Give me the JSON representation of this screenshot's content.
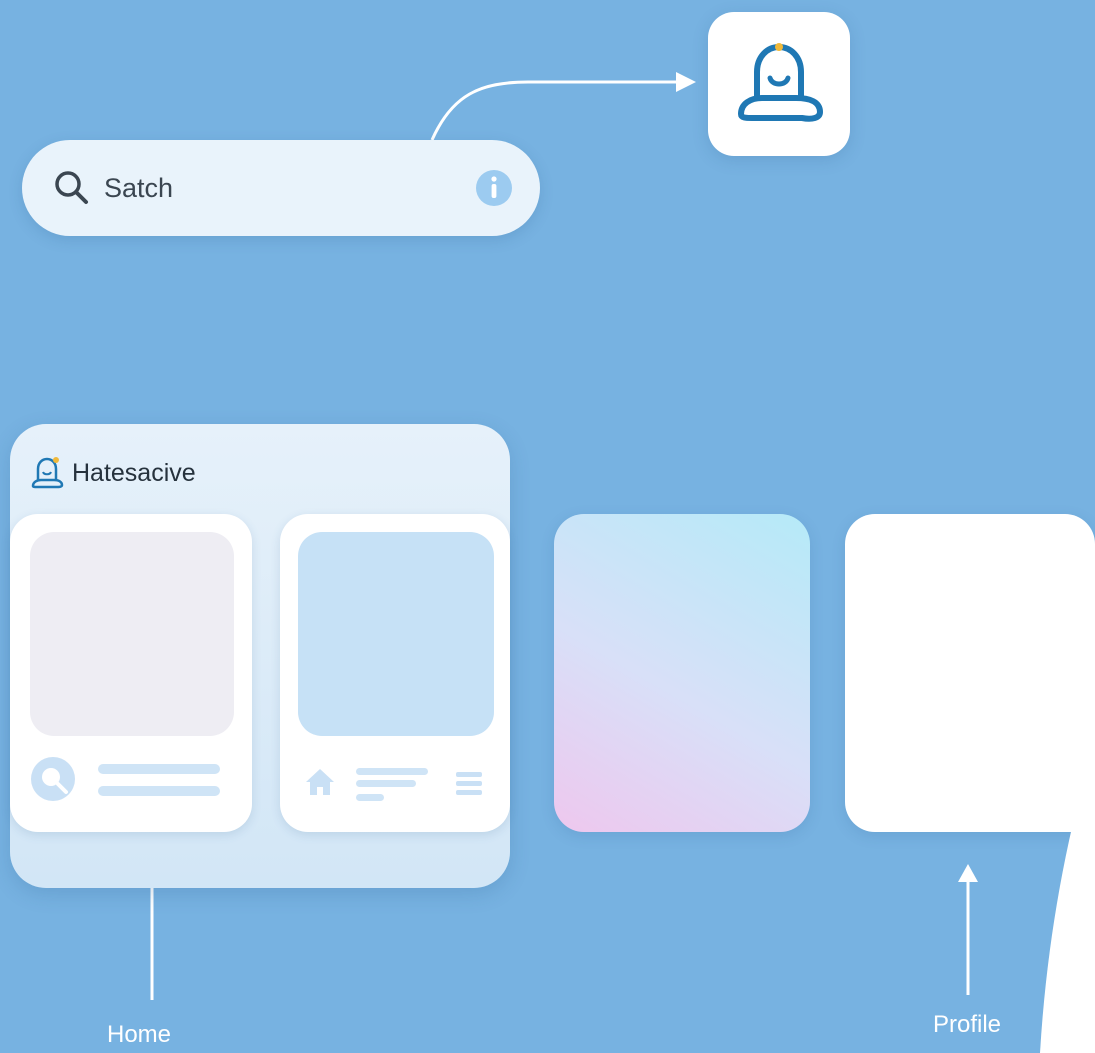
{
  "search": {
    "label": "Satch",
    "search_icon": "magnifier-icon",
    "info_icon": "info-icon"
  },
  "app_icon": {
    "icon": "bell-face-icon"
  },
  "home_panel": {
    "app_name": "Hatesacive",
    "app_icon": "bell-face-icon"
  },
  "cards": [
    {
      "name": "home-card",
      "icons": [
        "search-icon"
      ]
    },
    {
      "name": "list-card",
      "icons": [
        "home-icon",
        "menu-icon"
      ]
    }
  ],
  "captions": {
    "home": "Home",
    "profile": "Profile"
  },
  "colors": {
    "background": "#77b2e1",
    "accent": "#1f78b4",
    "info": "#9ccbf0"
  }
}
